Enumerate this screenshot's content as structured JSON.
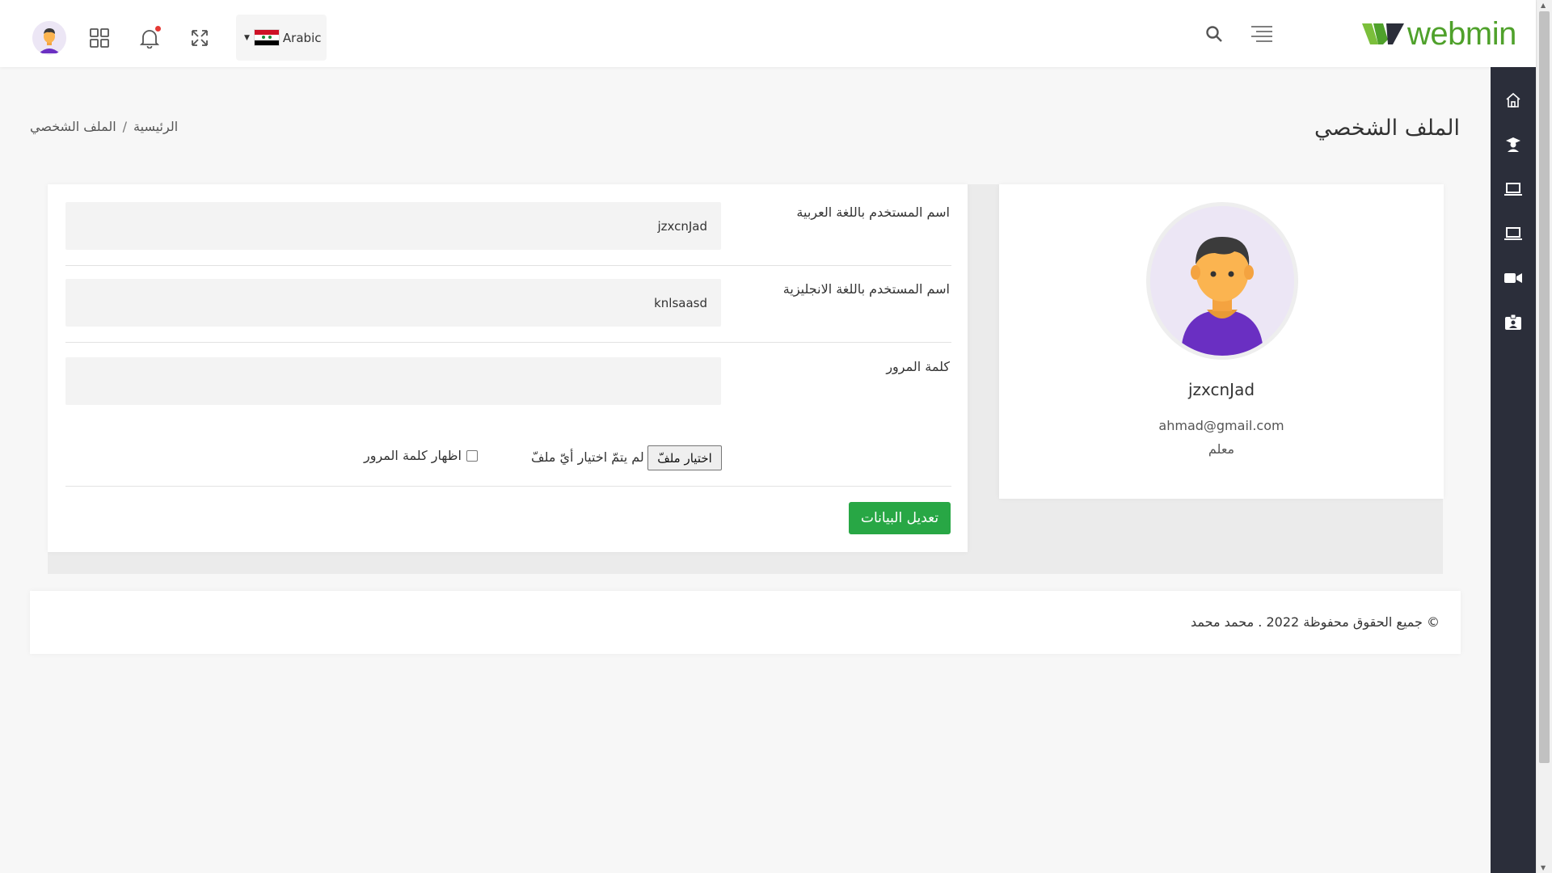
{
  "header": {
    "language": "Arabic",
    "brand": "webmin",
    "icons": [
      "avatar",
      "apps-grid-icon",
      "bell-icon",
      "fullscreen-icon",
      "search-icon",
      "menu-icon"
    ]
  },
  "sidebar": {
    "items": [
      "home-icon",
      "graduate-icon",
      "laptop-icon",
      "laptop-icon",
      "video-icon",
      "id-card-icon"
    ]
  },
  "page": {
    "title": "الملف الشخصي",
    "breadcrumb": {
      "home": "الرئيسية",
      "separator": "/",
      "current": "الملف الشخصي"
    }
  },
  "profile": {
    "name": "jzxcnJad",
    "email": "ahmad@gmail.com",
    "role": "معلم"
  },
  "form": {
    "arabic_name_label": "اسم المستخدم باللغة العربية",
    "arabic_name_value": "jzxcnJad",
    "english_name_label": "اسم المستخدم باللغة الانجليزية",
    "english_name_value": "knlsaasd",
    "password_label": "كلمة المرور",
    "password_value": "",
    "file_button": "اختيار ملفّ",
    "file_status": "لم يتمّ اختيار أيّ ملفّ",
    "show_password": "اظهار كلمة المرور",
    "submit": "تعديل البيانات"
  },
  "footer": {
    "text": "© جميع الحقوق محفوظة 2022 . محمد محمد"
  },
  "colors": {
    "sidebar": "#2b2e3a",
    "brand_green": "#4fa12b",
    "submit_green": "#28a745"
  }
}
